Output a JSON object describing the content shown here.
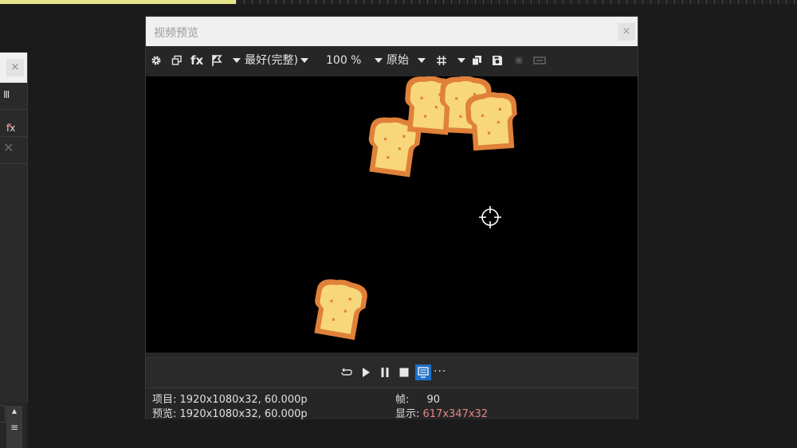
{
  "window": {
    "title": "视频预览",
    "close_glyph": "×"
  },
  "toolbar": {
    "quality_label": "最好(完整)",
    "zoom_label": "100 %",
    "size_label": "原始",
    "icons": [
      "gear-icon",
      "window-copy-icon",
      "fx-icon",
      "split-flag-icon",
      "grid-icon",
      "copy-icon",
      "save-snapshot-icon",
      "overlay-icon",
      "display-icon"
    ]
  },
  "transport": {
    "more_label": "···",
    "icons": [
      "loop-icon",
      "play-icon",
      "pause-icon",
      "stop-icon",
      "external-monitor-icon"
    ]
  },
  "status": {
    "project_label": "项目: ",
    "project_value": "1920x1080x32, 60.000p",
    "preview_label": "预览: ",
    "preview_value": "1920x1080x32, 60.000p",
    "frame_label": "帧: ",
    "frame_value": "90",
    "display_label": "显示: ",
    "display_value": "617x347x32"
  },
  "left_panel": {
    "close_glyph": "×",
    "row1_glyph": "Ⅲ",
    "fx_label": "fx",
    "fx_x": "✕",
    "remove_glyph": "✕",
    "scroll_up": "▲",
    "scroll_mid": "≡"
  },
  "colors": {
    "display_value": "#e58585",
    "active_button": "#1f6fc5",
    "timeline_highlight": "#e6e58a"
  }
}
